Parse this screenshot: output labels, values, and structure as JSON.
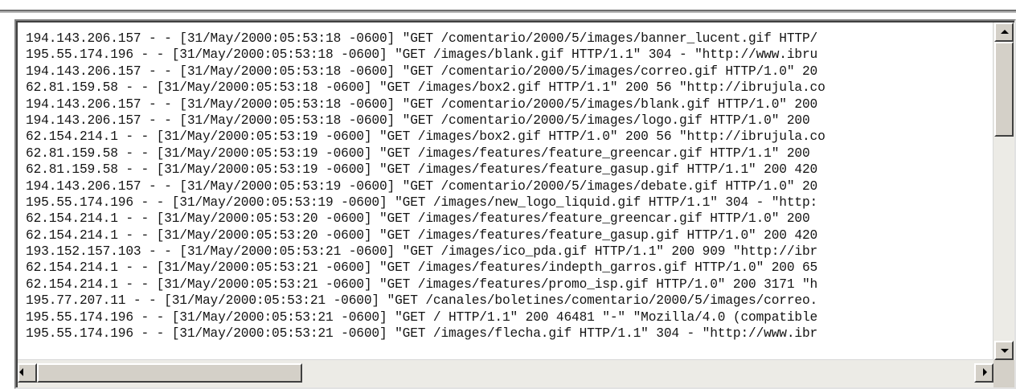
{
  "log": {
    "lines": [
      "194.143.206.157 - - [31/May/2000:05:53:18 -0600] \"GET /comentario/2000/5/images/banner_lucent.gif HTTP/",
      "195.55.174.196 - - [31/May/2000:05:53:18 -0600] \"GET /images/blank.gif HTTP/1.1\" 304 - \"http://www.ibru",
      "194.143.206.157 - - [31/May/2000:05:53:18 -0600] \"GET /comentario/2000/5/images/correo.gif HTTP/1.0\" 20",
      "62.81.159.58 - - [31/May/2000:05:53:18 -0600] \"GET /images/box2.gif HTTP/1.1\" 200 56 \"http://ibrujula.co",
      "194.143.206.157 - - [31/May/2000:05:53:18 -0600] \"GET /comentario/2000/5/images/blank.gif HTTP/1.0\" 200",
      "194.143.206.157 - - [31/May/2000:05:53:18 -0600] \"GET /comentario/2000/5/images/logo.gif HTTP/1.0\" 200",
      "62.154.214.1 - - [31/May/2000:05:53:19 -0600] \"GET /images/box2.gif HTTP/1.0\" 200 56 \"http://ibrujula.co",
      "62.81.159.58 - - [31/May/2000:05:53:19 -0600] \"GET /images/features/feature_greencar.gif HTTP/1.1\" 200",
      "62.81.159.58 - - [31/May/2000:05:53:19 -0600] \"GET /images/features/feature_gasup.gif HTTP/1.1\" 200 420",
      "194.143.206.157 - - [31/May/2000:05:53:19 -0600] \"GET /comentario/2000/5/images/debate.gif HTTP/1.0\" 20",
      "195.55.174.196 - - [31/May/2000:05:53:19 -0600] \"GET /images/new_logo_liquid.gif HTTP/1.1\" 304 - \"http:",
      "62.154.214.1 - - [31/May/2000:05:53:20 -0600] \"GET /images/features/feature_greencar.gif HTTP/1.0\" 200",
      "62.154.214.1 - - [31/May/2000:05:53:20 -0600] \"GET /images/features/feature_gasup.gif HTTP/1.0\" 200 420",
      "193.152.157.103 - - [31/May/2000:05:53:21 -0600] \"GET /images/ico_pda.gif HTTP/1.1\" 200 909 \"http://ibr",
      "62.154.214.1 - - [31/May/2000:05:53:21 -0600] \"GET /images/features/indepth_garros.gif HTTP/1.0\" 200 65",
      "62.154.214.1 - - [31/May/2000:05:53:21 -0600] \"GET /images/features/promo_isp.gif HTTP/1.0\" 200 3171 \"h",
      "195.77.207.11 - - [31/May/2000:05:53:21 -0600] \"GET /canales/boletines/comentario/2000/5/images/correo.",
      "195.55.174.196 - - [31/May/2000:05:53:21 -0600] \"GET / HTTP/1.1\" 200 46481 \"-\" \"Mozilla/4.0 (compatible",
      "195.55.174.196 - - [31/May/2000:05:53:21 -0600] \"GET /images/flecha.gif HTTP/1.1\" 304 - \"http://www.ibr"
    ]
  },
  "icons": {
    "scroll_up": "triangle-up-icon",
    "scroll_down": "triangle-down-icon",
    "scroll_left": "triangle-left-icon",
    "scroll_right": "triangle-right-icon"
  },
  "colors": {
    "text": "#141414",
    "scrollbar_track": "#ecebe6",
    "scrollbar_face": "#d4d0c8"
  }
}
